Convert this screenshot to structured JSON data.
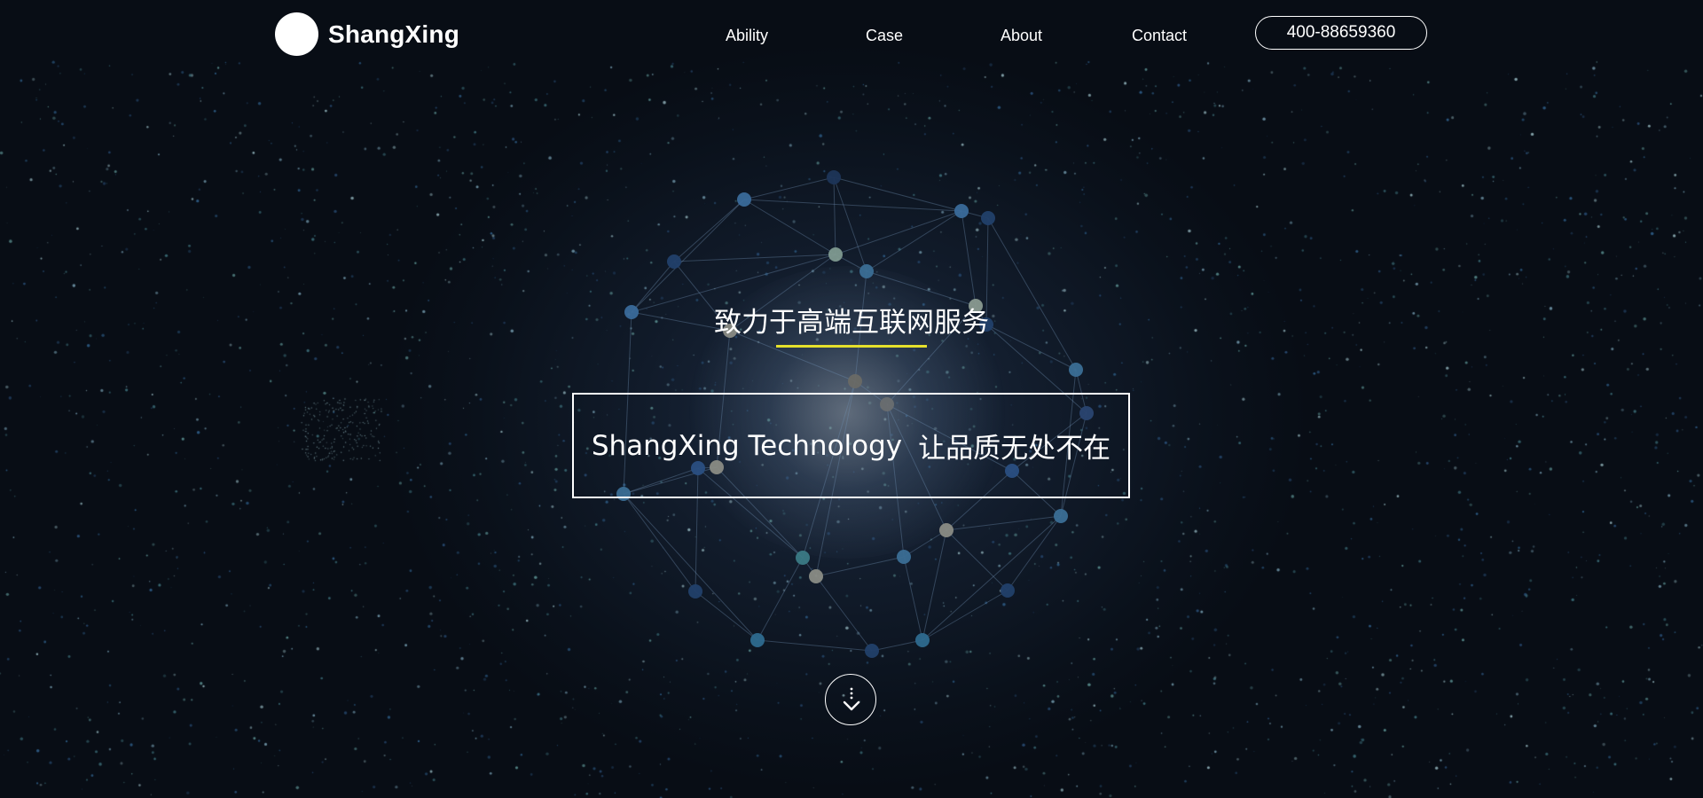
{
  "brand": {
    "name": "ShangXing"
  },
  "nav": {
    "items": [
      {
        "label": "Ability"
      },
      {
        "label": "Case"
      },
      {
        "label": "About"
      },
      {
        "label": "Contact"
      }
    ],
    "phone": "400-88659360"
  },
  "hero": {
    "tagline": "致力于高端互联网服务",
    "slogan_en": "ShangXing Technology",
    "slogan_cn": "让品质无处不在"
  },
  "icons": {
    "scroll": "chevron-down-icon"
  },
  "colors": {
    "background": "#080d15",
    "accent": "#e5e02c",
    "text": "#ffffff"
  }
}
